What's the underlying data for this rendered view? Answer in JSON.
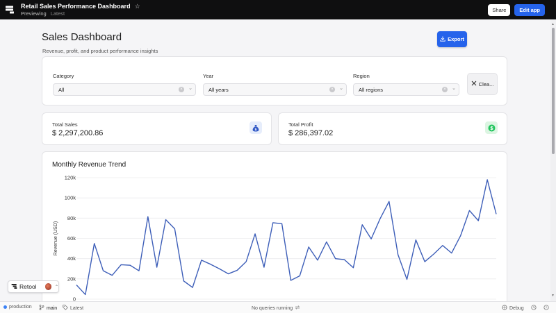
{
  "topbar": {
    "app_title": "Retail Sales Performance Dashboard",
    "mode": "Previewing",
    "version": "Latest",
    "share_label": "Share",
    "edit_label": "Edit app"
  },
  "page": {
    "title": "Sales Dashboard",
    "subtitle": "Revenue, profit, and product performance insights",
    "export_label": "Export"
  },
  "filters": {
    "category": {
      "label": "Category",
      "value": "All"
    },
    "year": {
      "label": "Year",
      "value": "All years"
    },
    "region": {
      "label": "Region",
      "value": "All regions"
    },
    "clear_label": "Clea..."
  },
  "stats": {
    "sales": {
      "label": "Total Sales",
      "value": "$ 2,297,200.86",
      "icon": "money-bag-icon"
    },
    "profit": {
      "label": "Total Profit",
      "value": "$ 286,397.02",
      "icon": "dollar-icon"
    }
  },
  "colors": {
    "accent": "#2563eb",
    "line": "#3d5eb8",
    "profit_icon": "#22c55e"
  },
  "chart_data": {
    "type": "line",
    "title": "Monthly Revenue Trend",
    "ylabel": "Revenue (USD)",
    "xlabel": "",
    "ylim": [
      0,
      120000
    ],
    "yticks": [
      "0",
      "20k",
      "40k",
      "60k",
      "80k",
      "100k",
      "120k"
    ],
    "ytick_values": [
      0,
      20000,
      40000,
      60000,
      80000,
      100000,
      120000
    ],
    "grid": true,
    "series": [
      {
        "values": [
          14000,
          4500,
          55000,
          28000,
          23500,
          34000,
          33500,
          28000,
          81500,
          31500,
          78500,
          69500,
          18000,
          11500,
          38500,
          34500,
          30000,
          25000,
          28500,
          37000,
          64500,
          31500,
          75500,
          74500,
          18500,
          23000,
          51500,
          38500,
          56500,
          40000,
          39000,
          31000,
          73500,
          59500,
          79500,
          96500,
          44000,
          19500,
          58500,
          37000,
          44500,
          53000,
          45500,
          62500,
          87500,
          77500,
          118000,
          84000
        ]
      }
    ]
  },
  "badge": {
    "label": "Retool"
  },
  "statusbar": {
    "environment": "production",
    "branch": "main",
    "release": "Latest",
    "queries": "No queries running",
    "debug": "Debug"
  }
}
